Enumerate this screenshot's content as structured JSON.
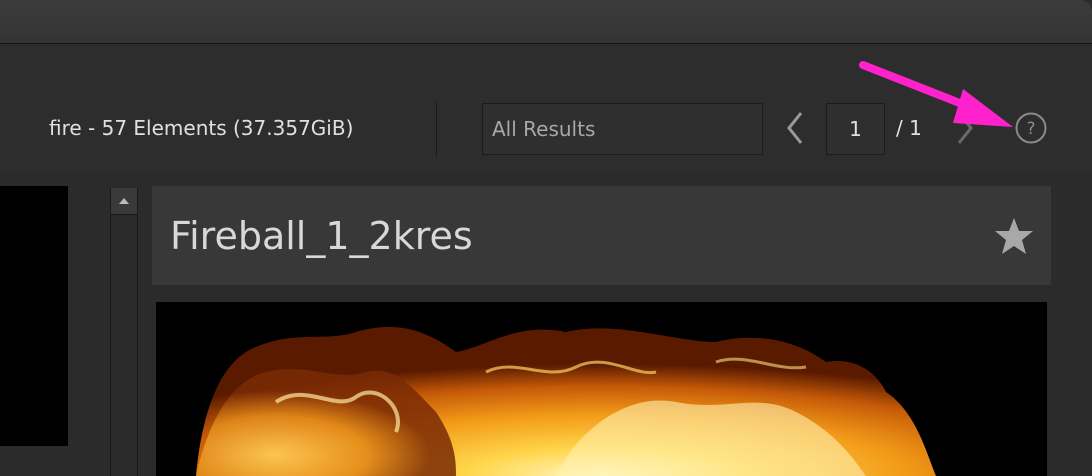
{
  "header": {
    "summary": "fire - 57 Elements (37.357GiB)",
    "filter_value": "All Results",
    "page_current": "1",
    "page_total": "/ 1",
    "prev_icon": "chevron-left-icon",
    "next_icon": "chevron-right-icon",
    "help_icon": "help-question-icon"
  },
  "annotation": {
    "arrow_color": "#ff22cc"
  },
  "detail": {
    "title": "Fireball_1_2kres",
    "favorite_icon": "star-icon"
  },
  "colors": {
    "background": "#2b2b2b",
    "panel": "#383838",
    "text": "#d8d8d8"
  }
}
